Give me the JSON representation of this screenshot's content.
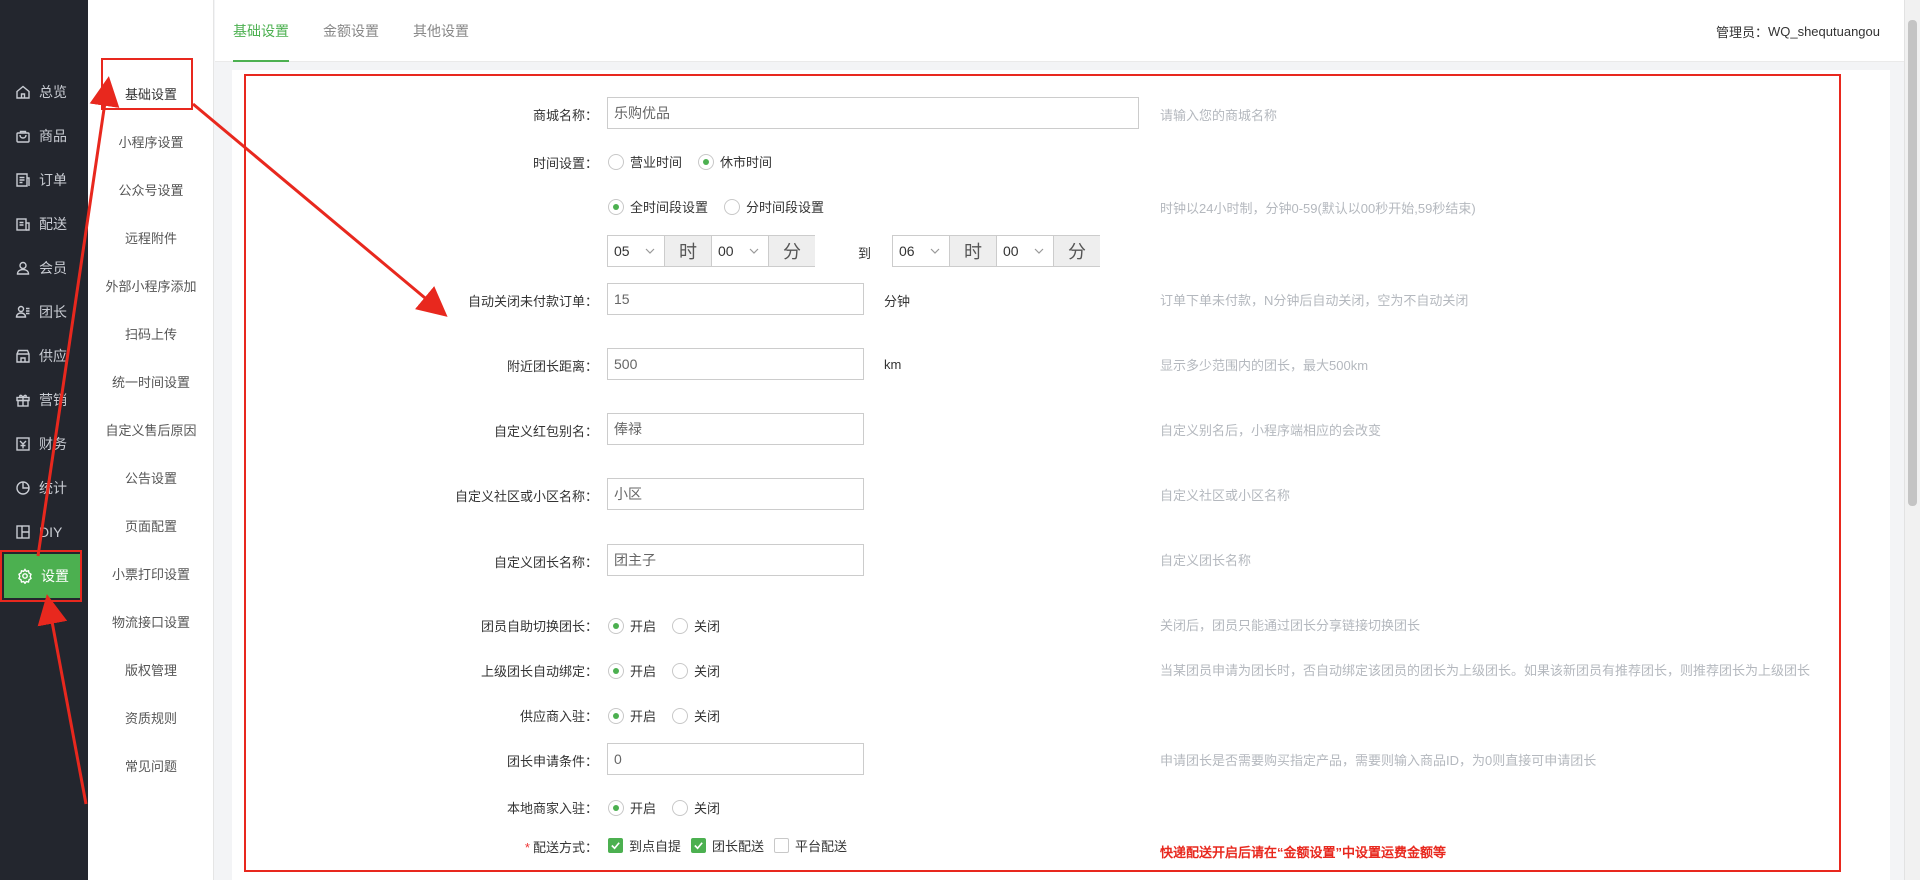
{
  "sidebar": {
    "items": [
      {
        "label": "总览",
        "icon": "home-icon"
      },
      {
        "label": "商品",
        "icon": "bag-icon"
      },
      {
        "label": "订单",
        "icon": "order-icon"
      },
      {
        "label": "配送",
        "icon": "delivery-icon"
      },
      {
        "label": "会员",
        "icon": "user-icon"
      },
      {
        "label": "团长",
        "icon": "leader-icon"
      },
      {
        "label": "供应",
        "icon": "store-icon"
      },
      {
        "label": "营销",
        "icon": "gift-icon"
      },
      {
        "label": "财务",
        "icon": "finance-icon"
      },
      {
        "label": "统计",
        "icon": "pie-chart-icon"
      },
      {
        "label": "DIY",
        "icon": "layout-icon"
      },
      {
        "label": "设置",
        "icon": "gear-icon"
      }
    ]
  },
  "submenu": {
    "items": [
      "基础设置",
      "小程序设置",
      "公众号设置",
      "远程附件",
      "外部小程序添加",
      "扫码上传",
      "统一时间设置",
      "自定义售后原因",
      "公告设置",
      "页面配置",
      "小票打印设置",
      "物流接口设置",
      "版权管理",
      "资质规则",
      "常见问题"
    ]
  },
  "header": {
    "tabs": [
      "基础设置",
      "金额设置",
      "其他设置"
    ],
    "admin_label": "管理员：",
    "admin_name": "WQ_shequtuangou"
  },
  "form": {
    "shop_name": {
      "label": "商城名称：",
      "value": "乐购优品",
      "hint": "请输入您的商城名称"
    },
    "time_setting": {
      "label": "时间设置：",
      "options": [
        "营业时间",
        "休市时间"
      ],
      "selected": "休市时间"
    },
    "time_mode": {
      "options": [
        "全时间段设置",
        "分时间段设置"
      ],
      "selected": "全时间段设置",
      "hint": "时钟以24小时制，分钟0-59(默认以00秒开始,59秒结束)"
    },
    "time_range": {
      "start_hour": "05",
      "start_min": "00",
      "end_hour": "06",
      "end_min": "00",
      "hour_unit": "时",
      "min_unit": "分",
      "to": "到"
    },
    "auto_close": {
      "label": "自动关闭未付款订单：",
      "value": "15",
      "unit": "分钟",
      "hint": "订单下单未付款，N分钟后自动关闭，空为不自动关闭"
    },
    "nearby_distance": {
      "label": "附近团长距离：",
      "value": "500",
      "unit": "km",
      "hint": "显示多少范围内的团长，最大500km"
    },
    "redpack_alias": {
      "label": "自定义红包别名：",
      "value": "俸禄",
      "hint": "自定义别名后，小程序端相应的会改变"
    },
    "community_name": {
      "label": "自定义社区或小区名称：",
      "value": "小区",
      "hint": "自定义社区或小区名称"
    },
    "leader_name": {
      "label": "自定义团长名称：",
      "value": "团主子",
      "hint": "自定义团长名称"
    },
    "member_switch": {
      "label": "团员自助切换团长：",
      "options": [
        "开启",
        "关闭"
      ],
      "selected": "开启",
      "hint": "关闭后，团员只能通过团长分享链接切换团长"
    },
    "superior_bind": {
      "label": "上级团长自动绑定：",
      "options": [
        "开启",
        "关闭"
      ],
      "selected": "开启",
      "hint": "当某团员申请为团长时，否自动绑定该团员的团长为上级团长。如果该新团员有推荐团长，则推荐团长为上级团长"
    },
    "supplier_join": {
      "label": "供应商入驻：",
      "options": [
        "开启",
        "关闭"
      ],
      "selected": "开启"
    },
    "leader_apply": {
      "label": "团长申请条件：",
      "value": "0",
      "hint": "申请团长是否需要购买指定产品，需要则输入商品ID，为0则直接可申请团长"
    },
    "local_merchant": {
      "label": "本地商家入驻：",
      "options": [
        "开启",
        "关闭"
      ],
      "selected": "开启"
    },
    "delivery": {
      "required_mark": "*",
      "label": "配送方式：",
      "options": [
        {
          "label": "到点自提",
          "checked": true
        },
        {
          "label": "团长配送",
          "checked": true
        },
        {
          "label": "平台配送",
          "checked": false
        }
      ],
      "hint": "快递配送开启后请在“金额设置”中设置运费金额等"
    }
  },
  "colors": {
    "accent": "#4cb050",
    "sidebar_bg": "#23262e",
    "annotation": "#e8281e"
  }
}
